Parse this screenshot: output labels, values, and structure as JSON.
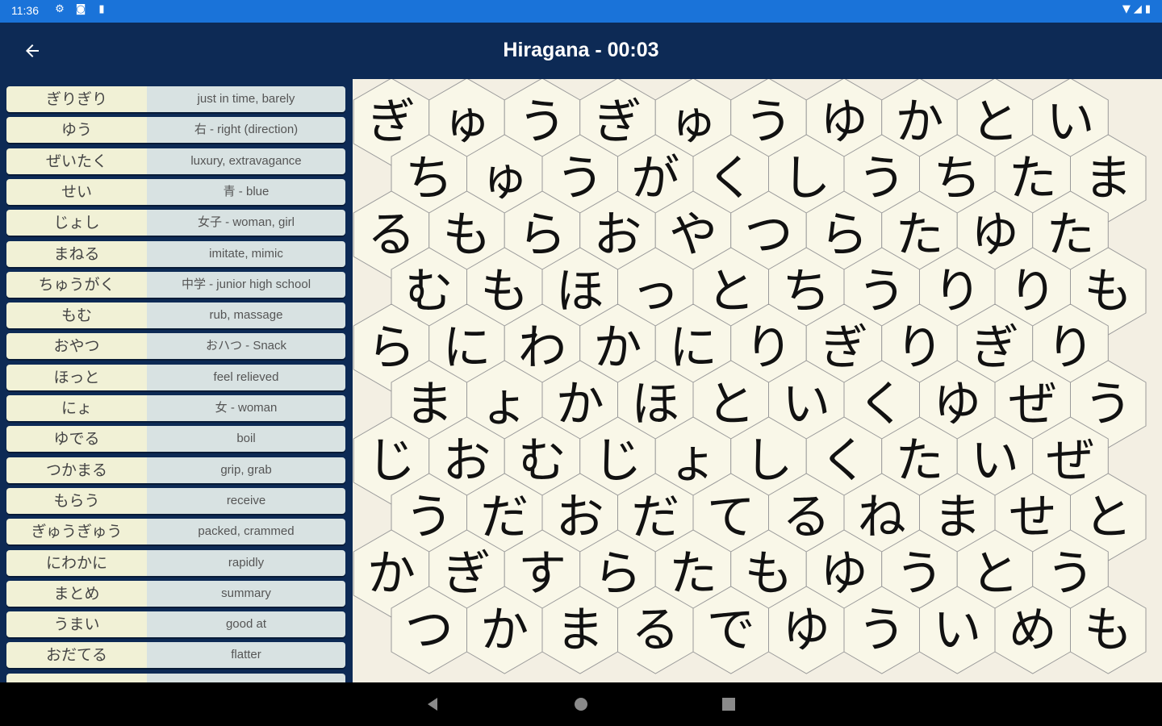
{
  "status": {
    "time": "11:36",
    "icons": [
      "settings-icon",
      "notification-icon",
      "sd-card-icon"
    ],
    "right_icons": [
      "wifi-icon",
      "signal-icon",
      "battery-icon"
    ]
  },
  "header": {
    "back_icon": "arrow-left-icon",
    "title": "Hiragana - 00:03"
  },
  "words": [
    {
      "kana": "ぎりぎり",
      "meaning": "just in time, barely"
    },
    {
      "kana": "ゆう",
      "meaning": "右 - right (direction)"
    },
    {
      "kana": "ぜいたく",
      "meaning": "luxury, extravagance"
    },
    {
      "kana": "せい",
      "meaning": "青 - blue"
    },
    {
      "kana": "じょし",
      "meaning": "女子 - woman, girl"
    },
    {
      "kana": "まねる",
      "meaning": "imitate, mimic"
    },
    {
      "kana": "ちゅうがく",
      "meaning": "中学 - junior high school"
    },
    {
      "kana": "もむ",
      "meaning": "rub, massage"
    },
    {
      "kana": "おやつ",
      "meaning": "おハつ - Snack"
    },
    {
      "kana": "ほっと",
      "meaning": "feel relieved"
    },
    {
      "kana": "にょ",
      "meaning": "女 - woman"
    },
    {
      "kana": "ゆでる",
      "meaning": "boil"
    },
    {
      "kana": "つかまる",
      "meaning": "grip, grab"
    },
    {
      "kana": "もらう",
      "meaning": "receive"
    },
    {
      "kana": "ぎゅうぎゅう",
      "meaning": "packed, crammed"
    },
    {
      "kana": "にわかに",
      "meaning": "rapidly"
    },
    {
      "kana": "まとめ",
      "meaning": "summary"
    },
    {
      "kana": "うまい",
      "meaning": "good at"
    },
    {
      "kana": "おだてる",
      "meaning": "flatter"
    }
  ],
  "grid": [
    [
      "ぎ",
      "ゅ",
      "う",
      "ぎ",
      "ゅ",
      "う",
      "ゆ",
      "か",
      "と",
      "い"
    ],
    [
      "ち",
      "ゅ",
      "う",
      "が",
      "く",
      "し",
      "う",
      "ち",
      "た",
      "ま"
    ],
    [
      "る",
      "も",
      "ら",
      "お",
      "や",
      "つ",
      "ら",
      "た",
      "ゆ",
      "た"
    ],
    [
      "む",
      "も",
      "ほ",
      "っ",
      "と",
      "ち",
      "う",
      "り",
      "り",
      "も"
    ],
    [
      "ら",
      "に",
      "わ",
      "か",
      "に",
      "り",
      "ぎ",
      "り",
      "ぎ",
      "り"
    ],
    [
      "ま",
      "ょ",
      "か",
      "ほ",
      "と",
      "い",
      "く",
      "ゆ",
      "ぜ",
      "う"
    ],
    [
      "じ",
      "お",
      "む",
      "じ",
      "ょ",
      "し",
      "く",
      "た",
      "い",
      "ぜ"
    ],
    [
      "う",
      "だ",
      "お",
      "だ",
      "て",
      "る",
      "ね",
      "ま",
      "せ",
      "と"
    ],
    [
      "か",
      "ぎ",
      "す",
      "ら",
      "た",
      "も",
      "ゆ",
      "う",
      "と",
      "う"
    ],
    [
      "つ",
      "か",
      "ま",
      "る",
      "で",
      "ゆ",
      "う",
      "い",
      "め",
      "も"
    ]
  ],
  "nav": {
    "back": "nav-back-icon",
    "home": "nav-home-icon",
    "recents": "nav-recents-icon"
  },
  "colors": {
    "status_bar": "#1a73d9",
    "app_bar": "#0d2a55",
    "board": "#f3efe3",
    "kana_cell": "#f1f1d6",
    "meaning_cell": "#d8e2e2"
  }
}
